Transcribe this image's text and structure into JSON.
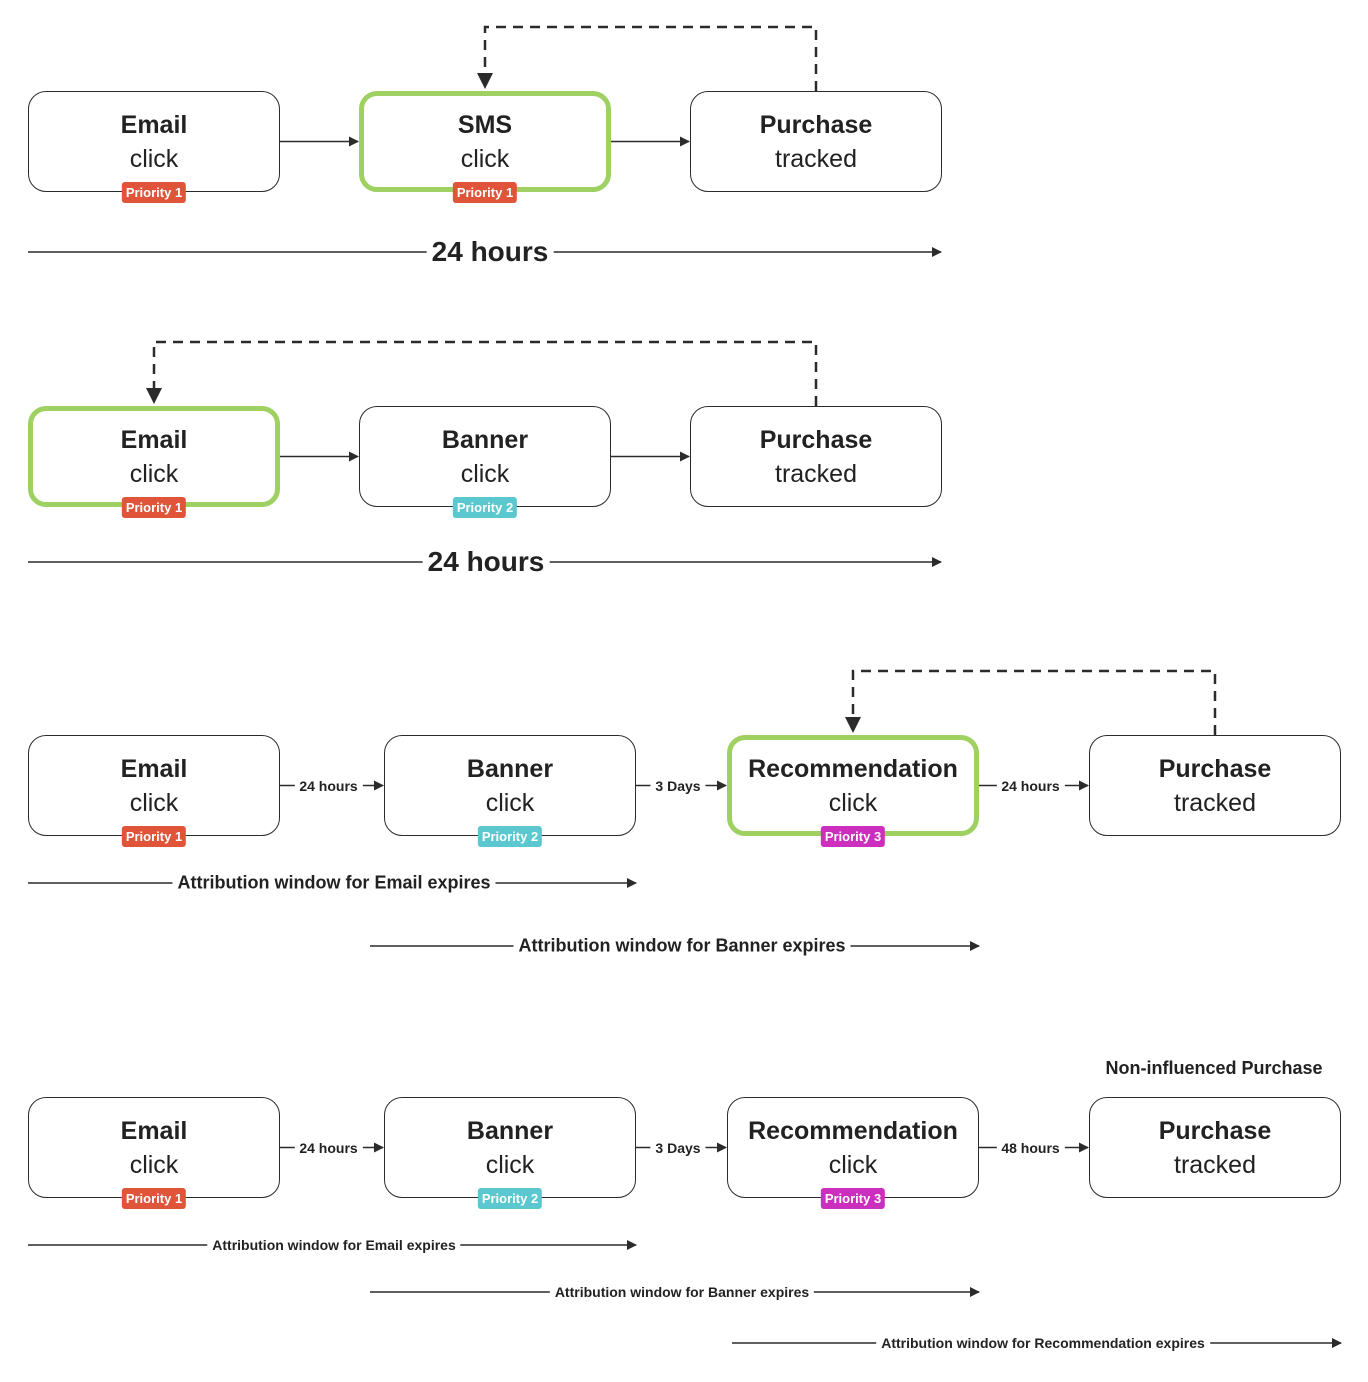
{
  "colors": {
    "highlight": "#9ED062",
    "priority_1": "#E0553A",
    "priority_2": "#5BC8D0",
    "priority_3": "#CC2FBE",
    "line": "#2b2b2b"
  },
  "diagrams": [
    {
      "nodes": [
        {
          "title": "Email",
          "subtitle": "click",
          "priority": "Priority 1",
          "level": 1
        },
        {
          "title": "SMS",
          "subtitle": "click",
          "priority": "Priority 1",
          "level": 1,
          "highlighted": true
        },
        {
          "title": "Purchase",
          "subtitle": "tracked"
        }
      ],
      "connectors": [
        "",
        ""
      ],
      "windows": [
        "24 hours"
      ]
    },
    {
      "nodes": [
        {
          "title": "Email",
          "subtitle": "click",
          "priority": "Priority 1",
          "level": 1,
          "highlighted": true
        },
        {
          "title": "Banner",
          "subtitle": "click",
          "priority": "Priority 2",
          "level": 2
        },
        {
          "title": "Purchase",
          "subtitle": "tracked"
        }
      ],
      "connectors": [
        "",
        ""
      ],
      "windows": [
        "24 hours"
      ]
    },
    {
      "nodes": [
        {
          "title": "Email",
          "subtitle": "click",
          "priority": "Priority 1",
          "level": 1
        },
        {
          "title": "Banner",
          "subtitle": "click",
          "priority": "Priority 2",
          "level": 2
        },
        {
          "title": "Recommendation",
          "subtitle": "click",
          "priority": "Priority 3",
          "level": 3,
          "highlighted": true
        },
        {
          "title": "Purchase",
          "subtitle": "tracked"
        }
      ],
      "connectors": [
        "24 hours",
        "3 Days",
        "24 hours"
      ],
      "windows": [
        "Attribution window for Email expires",
        "Attribution window for Banner expires"
      ]
    },
    {
      "note": "Non-influenced Purchase",
      "nodes": [
        {
          "title": "Email",
          "subtitle": "click",
          "priority": "Priority 1",
          "level": 1
        },
        {
          "title": "Banner",
          "subtitle": "click",
          "priority": "Priority 2",
          "level": 2
        },
        {
          "title": "Recommendation",
          "subtitle": "click",
          "priority": "Priority 3",
          "level": 3
        },
        {
          "title": "Purchase",
          "subtitle": "tracked"
        }
      ],
      "connectors": [
        "24 hours",
        "3 Days",
        "48 hours"
      ],
      "windows": [
        "Attribution window for Email expires",
        "Attribution window for Banner expires",
        "Attribution window for Recommendation expires"
      ]
    }
  ]
}
